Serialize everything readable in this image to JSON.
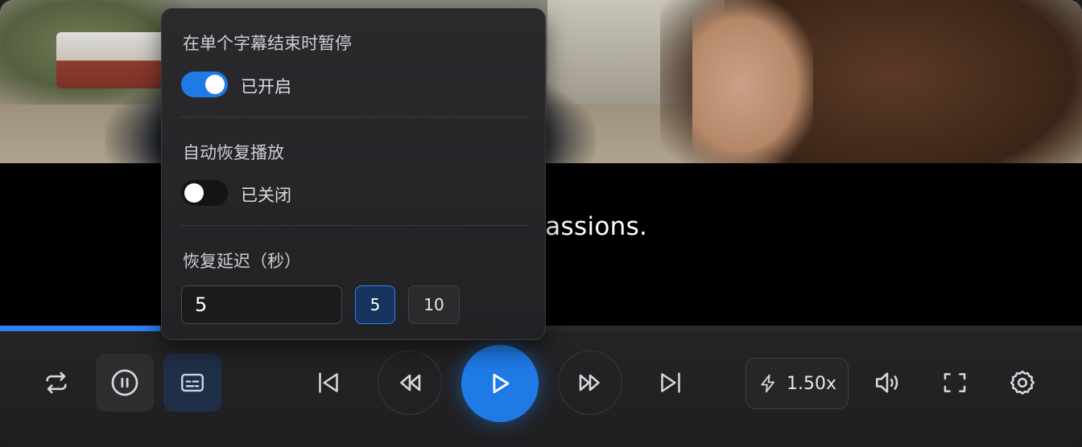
{
  "subtitle": {
    "text": "ow our passions."
  },
  "progress": {
    "fraction": 0.148
  },
  "colors": {
    "accent": "#1f7ae6",
    "control_bar": "#1f1f21",
    "popover": "#242427"
  },
  "popover": {
    "pause_at_end": {
      "title": "在单个字幕结束时暂停",
      "enabled": true,
      "state_label": "已开启"
    },
    "auto_resume": {
      "title": "自动恢复播放",
      "enabled": false,
      "state_label": "已关闭"
    },
    "resume_delay": {
      "title": "恢复延迟（秒）",
      "input_value": "5",
      "options": [
        {
          "label": "5",
          "selected": true
        },
        {
          "label": "10",
          "selected": false
        }
      ]
    }
  },
  "controls": {
    "loop_icon": "repeat-icon",
    "pause_icon": "pause-circle-icon",
    "subtitle_icon": "subtitle-icon",
    "prev_icon": "skip-previous-icon",
    "rewind_icon": "rewind-icon",
    "play_icon": "play-icon",
    "forward_icon": "fast-forward-icon",
    "next_icon": "skip-next-icon",
    "speed": {
      "icon": "lightning-icon",
      "label": "1.50x"
    },
    "volume_icon": "volume-icon",
    "fullscreen_icon": "fullscreen-icon",
    "settings_icon": "gear-icon"
  }
}
